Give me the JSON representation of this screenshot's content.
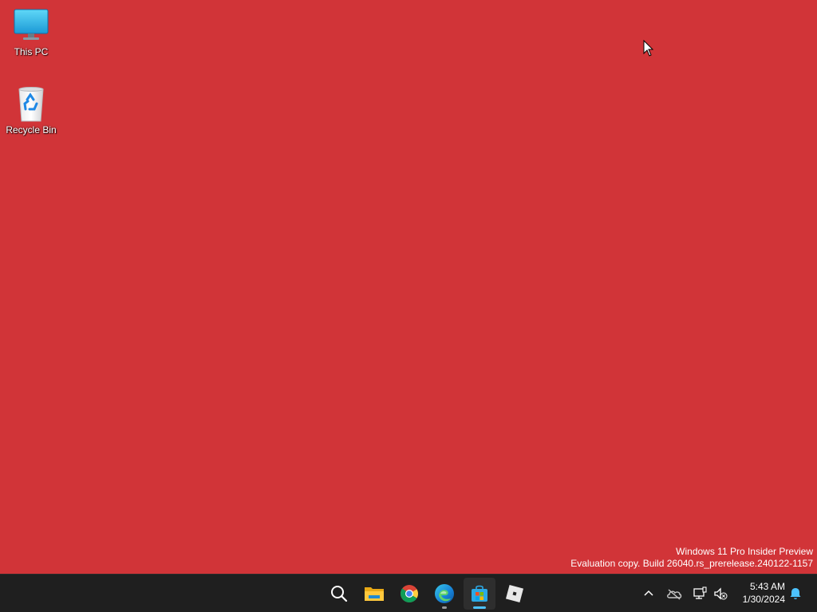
{
  "desktop": {
    "background_color": "#d13438",
    "icons": [
      {
        "label": "This PC",
        "icon": "monitor-icon"
      },
      {
        "label": "Recycle Bin",
        "icon": "recycle-bin-icon"
      }
    ],
    "watermark": {
      "line1": "Windows 11 Pro Insider Preview",
      "line2": "Evaluation copy. Build 26040.rs_prerelease.240122-1157"
    }
  },
  "taskbar": {
    "background_color": "#1f1f1f",
    "apps": [
      {
        "name": "Search",
        "icon": "search-icon",
        "state": "idle"
      },
      {
        "name": "File Explorer",
        "icon": "folder-icon",
        "state": "idle"
      },
      {
        "name": "Google Chrome",
        "icon": "chrome-icon",
        "state": "idle"
      },
      {
        "name": "Microsoft Edge",
        "icon": "edge-icon",
        "state": "running"
      },
      {
        "name": "Microsoft Store",
        "icon": "store-icon",
        "state": "focused"
      },
      {
        "name": "Roblox",
        "icon": "roblox-icon",
        "state": "idle"
      }
    ],
    "tray": {
      "icons": [
        "chevron-up-icon",
        "onedrive-icon",
        "network-icon",
        "volume-muted-icon"
      ],
      "time": "5:43 AM",
      "date": "1/30/2024",
      "notification_icon": "bell-icon"
    },
    "accent_color": "#4cc2ff"
  }
}
